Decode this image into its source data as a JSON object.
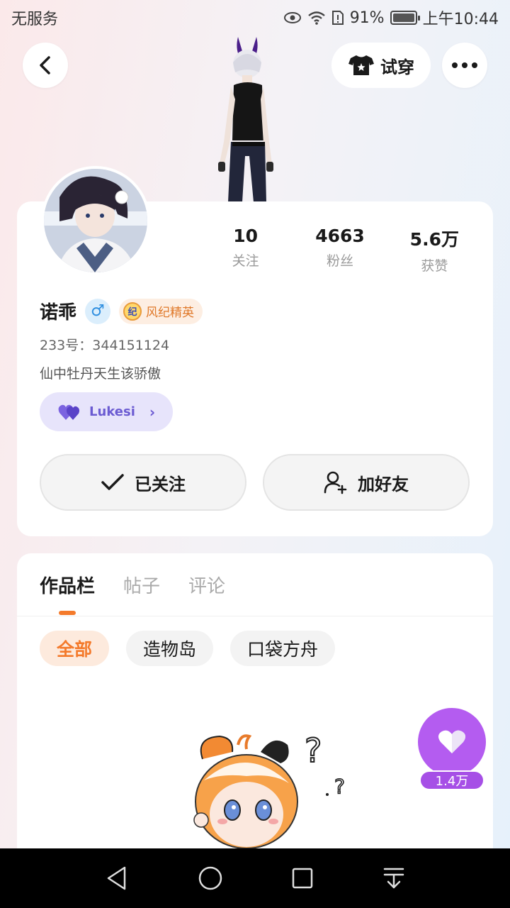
{
  "status_bar": {
    "carrier": "无服务",
    "battery": "91%",
    "battery_level": 0.91,
    "time": "上午10:44"
  },
  "header": {
    "try_on_label": "试穿"
  },
  "profile": {
    "stats": [
      {
        "value": "10",
        "label": "关注"
      },
      {
        "value": "4663",
        "label": "粉丝"
      },
      {
        "value": "5.6万",
        "label": "获赞"
      }
    ],
    "name": "诺乖",
    "gender_symbol": "♂",
    "badge_icon_text": "纪",
    "badge_label": "风纪精英",
    "uid": "233号：344151124",
    "bio": "仙中牡丹天生该骄傲",
    "guild_name": "Lukesi",
    "follow_button": "已关注",
    "add_friend_button": "加好友"
  },
  "works": {
    "tabs": [
      "作品栏",
      "帖子",
      "评论"
    ],
    "active_tab": 0,
    "filters": [
      "全部",
      "造物岛",
      "口袋方舟"
    ],
    "active_filter": 0,
    "like_count": "1.4万"
  },
  "colors": {
    "accent_orange": "#f47a2b",
    "guild_purple": "#6b5bd2",
    "like_purple": "#b45cf0"
  }
}
